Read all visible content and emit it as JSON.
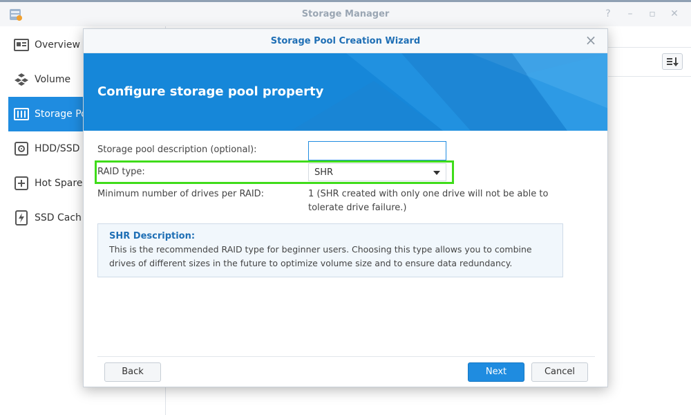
{
  "app": {
    "title": "Storage Manager"
  },
  "sidebar": {
    "items": [
      {
        "label": "Overview",
        "icon": "overview-icon",
        "active": false
      },
      {
        "label": "Volume",
        "icon": "volume-icon",
        "active": false
      },
      {
        "label": "Storage Po",
        "icon": "storage-pool-icon",
        "active": true
      },
      {
        "label": "HDD/SSD",
        "icon": "hdd-icon",
        "active": false
      },
      {
        "label": "Hot Spare",
        "icon": "hot-spare-icon",
        "active": false
      },
      {
        "label": "SSD Cach",
        "icon": "ssd-cache-icon",
        "active": false
      }
    ]
  },
  "modal": {
    "title": "Storage Pool Creation Wizard",
    "banner_title": "Configure storage pool property",
    "description_label": "Storage pool description (optional):",
    "description_value": "",
    "raid_label": "RAID type:",
    "raid_value": "SHR",
    "min_drives_label": "Minimum number of drives per RAID:",
    "min_drives_info": "1 (SHR created with only one drive will not be able to tolerate drive failure.)",
    "shr_title": "SHR Description:",
    "shr_text": "This is the recommended RAID type for beginner users. Choosing this type allows you to combine drives of different sizes in the future to optimize volume size and to ensure data redundancy.",
    "buttons": {
      "back": "Back",
      "next": "Next",
      "cancel": "Cancel"
    }
  },
  "colors": {
    "accent": "#1f8ce0",
    "highlight": "#3fdc1a",
    "banner": "#1687d9"
  }
}
